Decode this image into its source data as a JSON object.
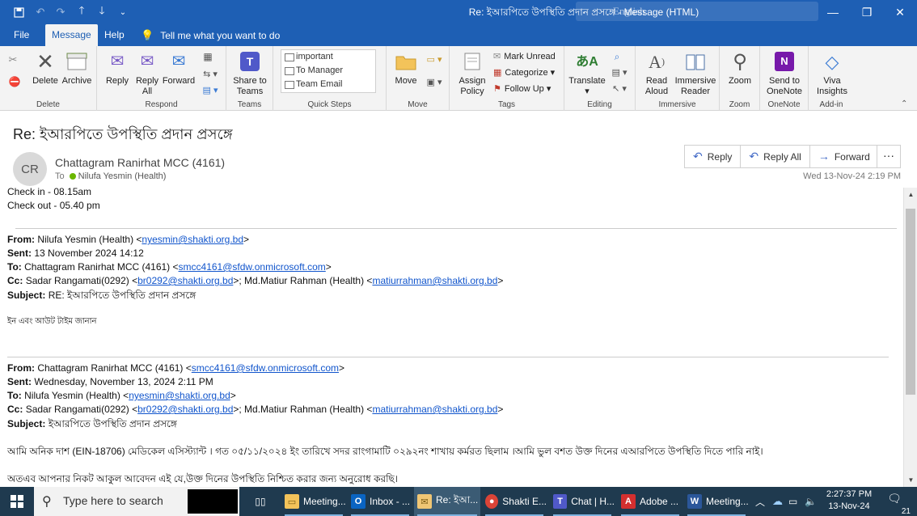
{
  "titlebar": {
    "title": "Re: ইআরপিতে উপস্থিতি প্রদান প্রসঙ্গে  -  Message (HTML)",
    "lang": "English"
  },
  "menu": {
    "tabs": [
      "File",
      "Message",
      "Help"
    ],
    "active": "Message",
    "tell_me": "Tell me what you want to do"
  },
  "ribbon": {
    "delete": {
      "delete": "Delete",
      "archive": "Archive",
      "group": "Delete"
    },
    "respond": {
      "reply": "Reply",
      "reply_all_1": "Reply",
      "reply_all_2": "All",
      "forward": "Forward",
      "group": "Respond"
    },
    "teams": {
      "share_1": "Share to",
      "share_2": "Teams",
      "group": "Teams"
    },
    "quick_steps": {
      "items": [
        "important",
        "To Manager",
        "Team Email"
      ],
      "group": "Quick Steps"
    },
    "move": {
      "move": "Move",
      "group": "Move"
    },
    "tags": {
      "assign_1": "Assign",
      "assign_2": "Policy",
      "mark_unread": "Mark Unread",
      "categorize": "Categorize",
      "follow_up": "Follow Up",
      "group": "Tags"
    },
    "editing": {
      "translate": "Translate",
      "group": "Editing"
    },
    "immersive": {
      "read_1": "Read",
      "read_2": "Aloud",
      "reader_1": "Immersive",
      "reader_2": "Reader",
      "group": "Immersive"
    },
    "zoom": {
      "zoom": "Zoom",
      "group": "Zoom"
    },
    "onenote": {
      "send_1": "Send to",
      "send_2": "OneNote",
      "group": "OneNote"
    },
    "addin": {
      "viva_1": "Viva",
      "viva_2": "Insights",
      "group": "Add-in"
    }
  },
  "message": {
    "subject": "Re: ইআরপিতে উপস্থিতি প্রদান প্রসঙ্গে",
    "avatar": "CR",
    "sender": "Chattagram Ranirhat MCC (4161)",
    "to_label": "To",
    "to_name": "Nilufa Yesmin (Health)",
    "date": "Wed 13-Nov-24 2:19 PM",
    "actions": {
      "reply": "Reply",
      "reply_all": "Reply All",
      "forward": "Forward",
      "more": "···"
    }
  },
  "body": {
    "line1": "Check in - 08.15am",
    "line2": "Check out - 05.40 pm",
    "q1": {
      "from_label": "From:",
      "from": "Nilufa Yesmin (Health) <",
      "from_email": "nyesmin@shakti.org.bd",
      "from_end": ">",
      "sent_label": "Sent:",
      "sent": "13 November 2024 14:12",
      "to_label": "To:",
      "to": "Chattagram Ranirhat MCC (4161) <",
      "to_email": "smcc4161@sfdw.onmicrosoft.com",
      "to_end": ">",
      "cc_label": "Cc:",
      "cc1": "Sadar Rangamati(0292) <",
      "cc1_email": "br0292@shakti.org.bd",
      "cc_mid": ">; Md.Matiur Rahman (Health) <",
      "cc2_email": "matiurrahman@shakti.org.bd",
      "cc_end": ">",
      "subject_label": "Subject:",
      "subject": "RE: ইআরপিতে উপস্থিতি প্রদান প্রসঙ্গে",
      "text": "ইন এবং আউট টাইম জানান"
    },
    "q2": {
      "from_label": "From:",
      "from": "Chattagram Ranirhat MCC (4161) <",
      "from_email": "smcc4161@sfdw.onmicrosoft.com",
      "from_end": ">",
      "sent_label": "Sent:",
      "sent": "Wednesday, November 13, 2024 2:11 PM",
      "to_label": "To:",
      "to": "Nilufa Yesmin (Health) <",
      "to_email": "nyesmin@shakti.org.bd",
      "to_end": ">",
      "cc_label": "Cc:",
      "cc1": "Sadar Rangamati(0292) <",
      "cc1_email": "br0292@shakti.org.bd",
      "cc_mid": ">; Md.Matiur Rahman (Health) <",
      "cc2_email": "matiurrahman@shakti.org.bd",
      "cc_end": ">",
      "subject_label": "Subject:",
      "subject": "ইআরপিতে উপস্থিতি প্রদান প্রসঙ্গে",
      "para1": "আমি অনিক দাশ (EIN-18706) মেডিকেল এসিস্ট্যান্ট । গত ০৫/১১/২০২৪ ইং তারিখে সদর রাংগামাটি ০২৯২নং শাখায় কর্মরত ছিলাম ।আমি ভুল বশত উক্ত দিনের এআরপিতে উপস্থিতি দিতে পারি নাই।",
      "para2": "অতএব আপনার নিকট আকুল আবেদন এই যে,উক্ত দিনের উপস্থিতি নিশ্চিত করার জন্য অনুরোধ করছি।"
    }
  },
  "taskbar": {
    "search": "Type here to search",
    "apps": [
      "Meeting...",
      "Inbox - ...",
      "Re: ইআ...",
      "Shakti E...",
      "Chat | H...",
      "Adobe ...",
      "Meeting..."
    ],
    "time": "2:27:37 PM",
    "date": "13-Nov-24",
    "notif_count": "21"
  },
  "colors": {
    "accent": "#1e5fb4",
    "taskbar": "#1f3a4f",
    "link": "#1155cc"
  }
}
